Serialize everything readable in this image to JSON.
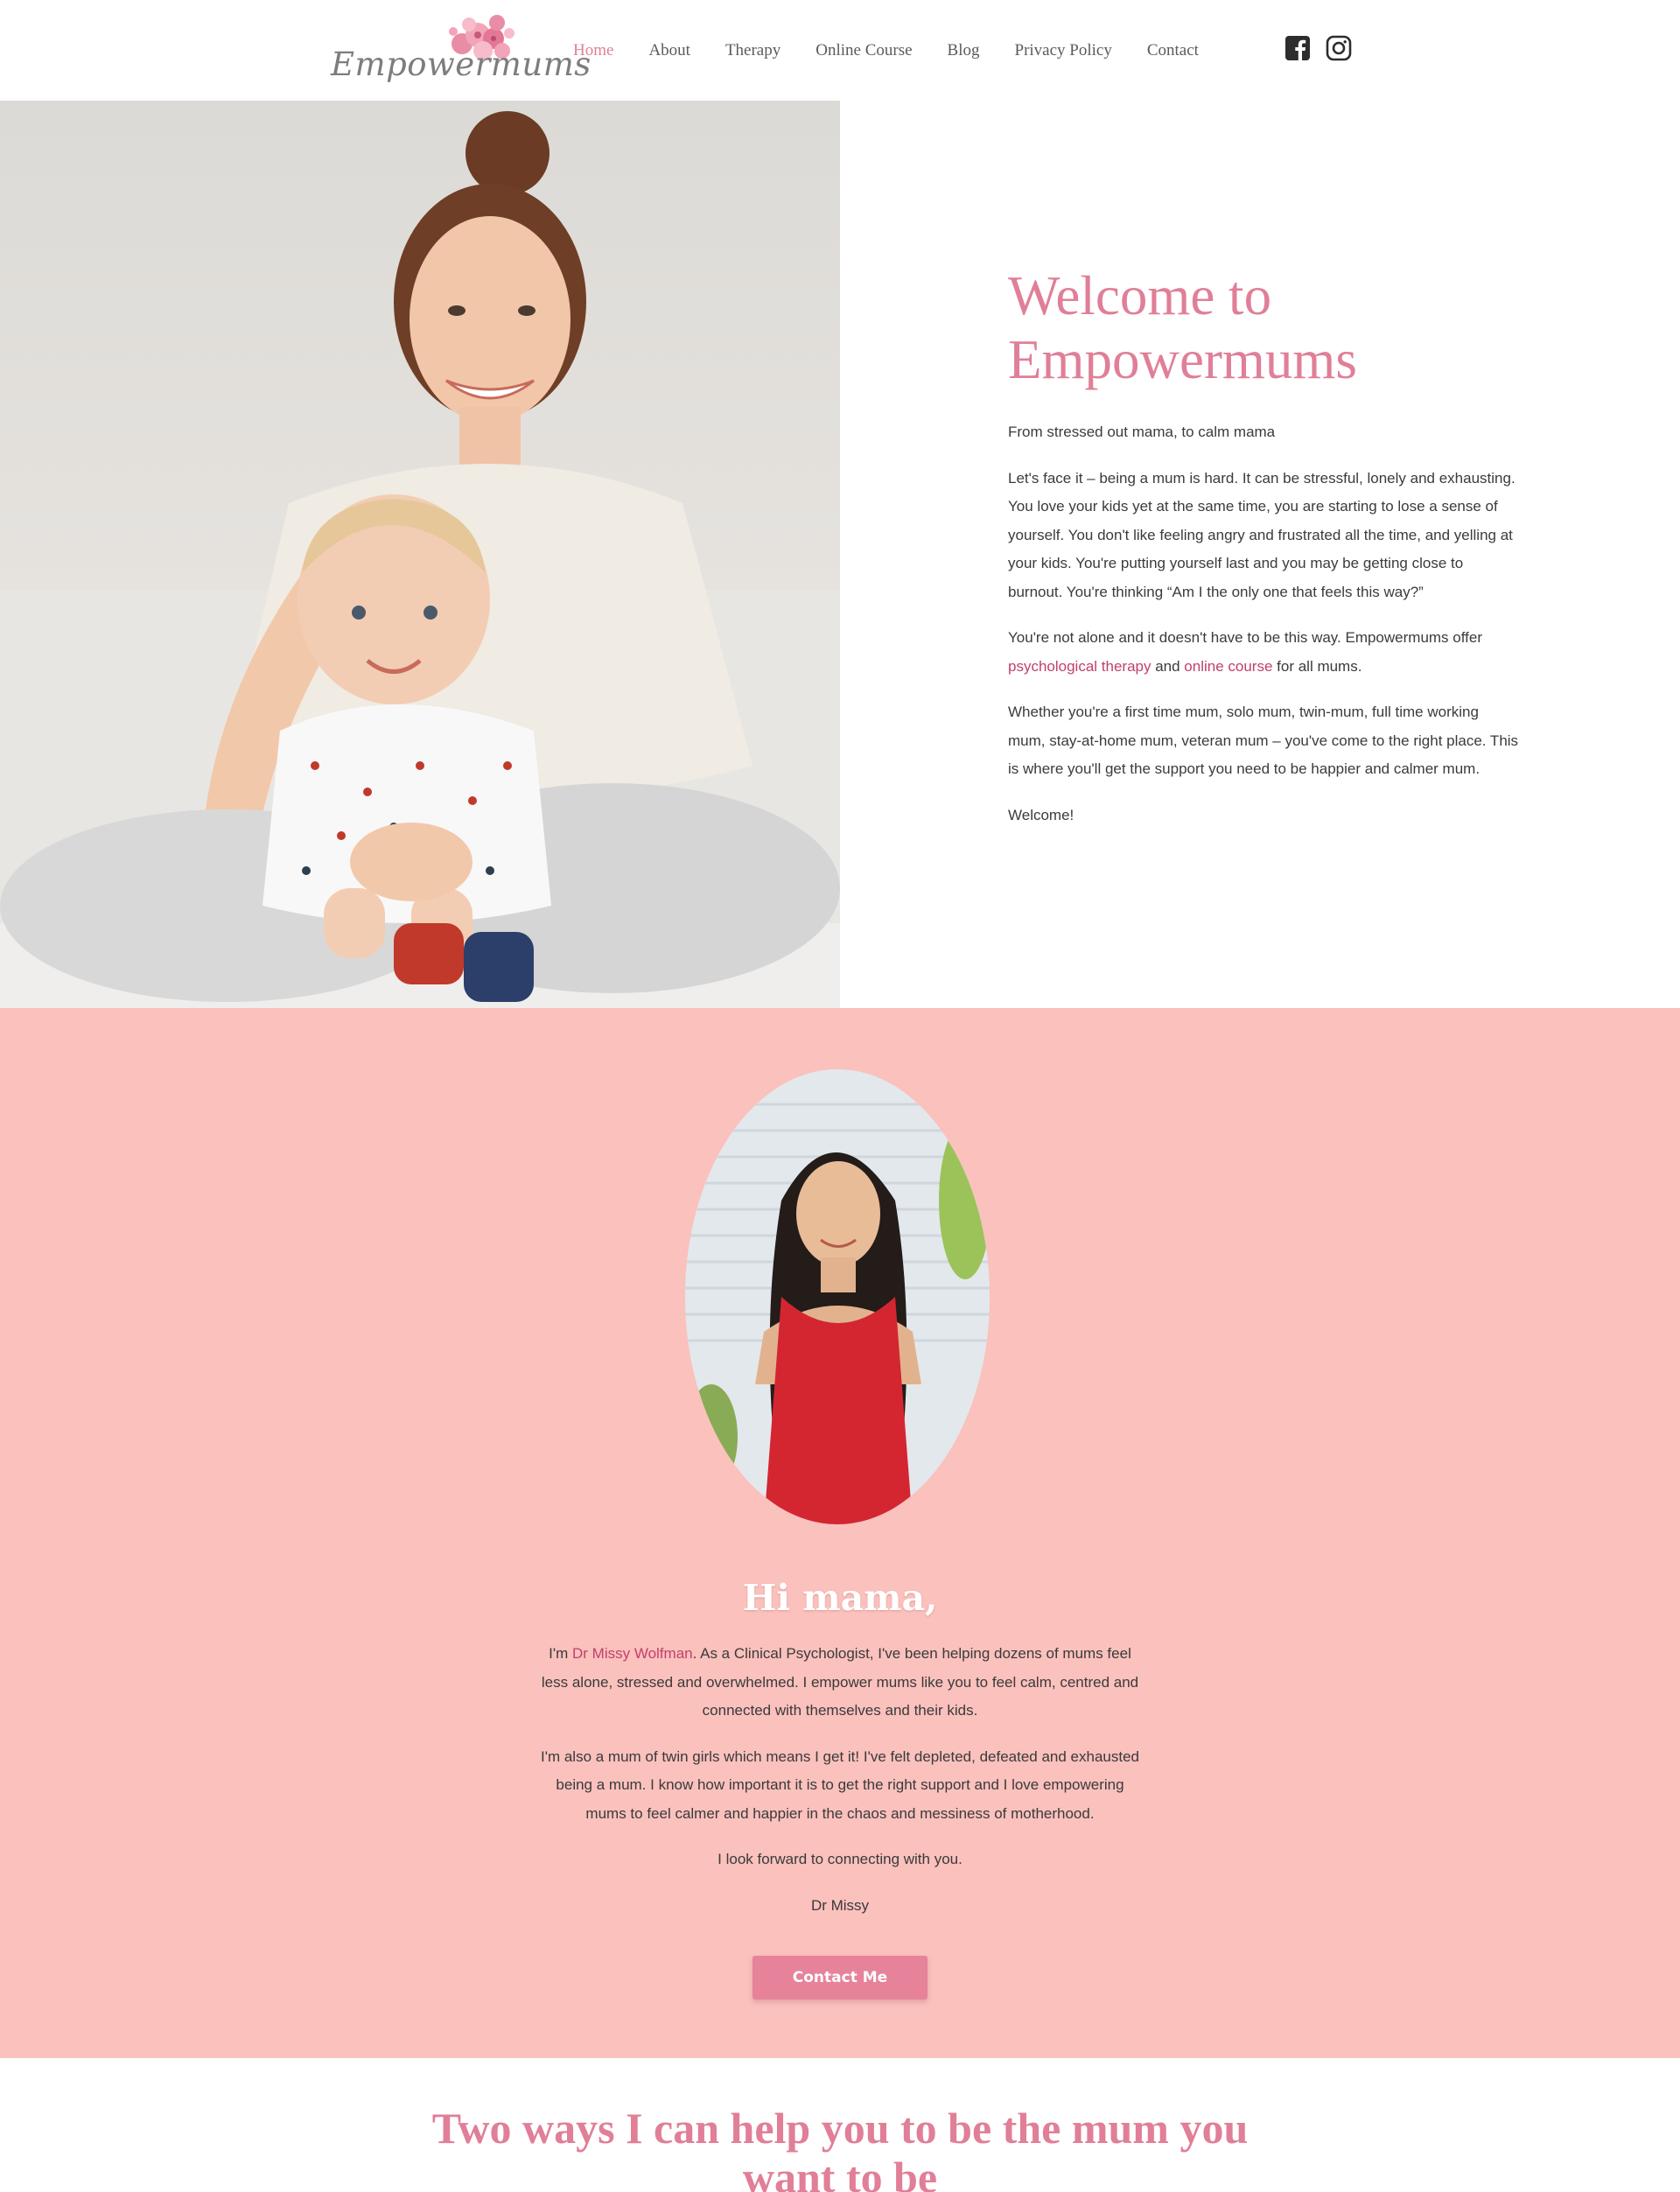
{
  "header": {
    "logo_text": "Empowermums",
    "nav": [
      {
        "label": "Home",
        "active": true
      },
      {
        "label": "About"
      },
      {
        "label": "Therapy"
      },
      {
        "label": "Online Course"
      },
      {
        "label": "Blog"
      },
      {
        "label": "Privacy Policy"
      },
      {
        "label": "Contact"
      }
    ],
    "social": [
      "facebook-icon",
      "instagram-icon"
    ]
  },
  "hero": {
    "title": "Welcome to Empowermums",
    "tagline": "From stressed out mama, to calm mama",
    "p1": "Let's face it – being a mum is hard. It can be stressful, lonely and exhausting. You love your kids yet at the same time, you are starting to lose a sense of yourself. You don't like feeling angry and frustrated all the time, and yelling at your kids. You're putting yourself last and you may be getting close to burnout. You're thinking “Am I the only one that feels this way?”",
    "p2_before": "You're not alone and it doesn't have to be this way. Empowermums offer ",
    "p2_link1": "psychological therapy",
    "p2_mid": " and ",
    "p2_link2": "online course",
    "p2_after": " for all mums.",
    "p3": "Whether you're a first time mum, solo mum, twin-mum, full time working mum, stay-at-home mum, veteran mum – you've come to the right place. This is where you'll get the support you need to be happier and calmer mum.",
    "p4": "Welcome!"
  },
  "intro": {
    "title": "Hi mama,",
    "p1_before": "I'm ",
    "p1_link": "Dr Missy Wolfman",
    "p1_after": ". As a Clinical Psychologist, I've been helping dozens of mums feel less alone, stressed and overwhelmed. I empower mums like you to feel calm, centred and connected with themselves and their kids.",
    "p2": "I'm also a mum of twin girls which means I get it! I've felt depleted, defeated and exhausted being a mum. I know how important it is to get the right support and I love empowering mums to feel calmer and happier in the chaos and messiness of motherhood.",
    "p3": "I look forward to connecting with you.",
    "signature": "Dr Missy",
    "button": "Contact Me"
  },
  "section2": {
    "title": "Two ways I can help you to be the mum you want to be"
  },
  "colors": {
    "accent": "#e07f97",
    "link": "#c2406b",
    "band": "#fac1bd",
    "button": "#e6839b"
  }
}
